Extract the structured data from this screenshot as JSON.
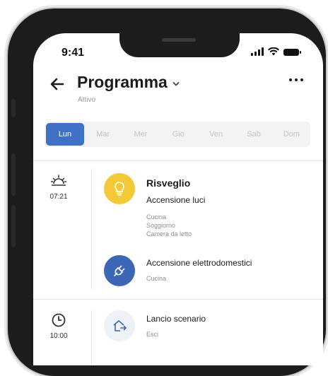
{
  "status_bar": {
    "time": "9:41"
  },
  "header": {
    "title": "Programma",
    "subtitle": "Attivo"
  },
  "days": [
    {
      "label": "Lun",
      "active": true
    },
    {
      "label": "Mar",
      "active": false
    },
    {
      "label": "Mer",
      "active": false
    },
    {
      "label": "Gio",
      "active": false
    },
    {
      "label": "Ven",
      "active": false
    },
    {
      "label": "Sab",
      "active": false
    },
    {
      "label": "Dom",
      "active": false
    }
  ],
  "schedule": [
    {
      "icon": "sunrise-icon",
      "time": "07:21",
      "event_title": "Risveglio",
      "actions": [
        {
          "icon": "lightbulb-icon",
          "color": "#f3c93a",
          "title": "Accensione luci",
          "details": [
            "Cucina",
            "Soggiorno",
            "Camera da letto"
          ]
        },
        {
          "icon": "plug-icon",
          "color": "#3c67b6",
          "title": "Accensione elettrodomestici",
          "details": [
            "Cucina"
          ]
        }
      ]
    },
    {
      "icon": "clock-icon",
      "time": "10:00",
      "actions": [
        {
          "icon": "home-exit-icon",
          "color": "#eef1f7",
          "title": "Lancio scenario",
          "details": [
            "Esci"
          ]
        }
      ]
    }
  ],
  "colors": {
    "accent": "#3f72c7",
    "bulb": "#f3c93a",
    "plug": "#3c67b6"
  }
}
